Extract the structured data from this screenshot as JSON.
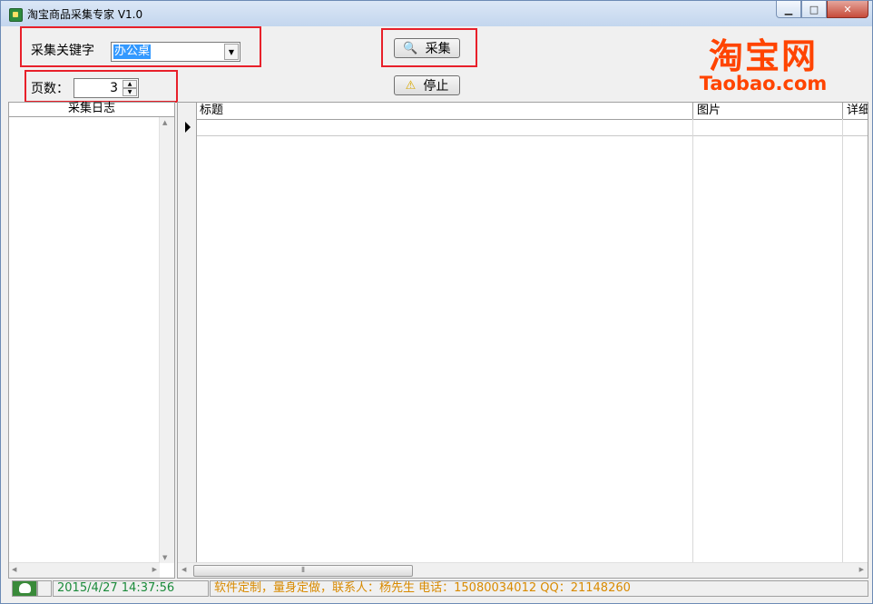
{
  "window": {
    "title": "淘宝商品采集专家 V1.0",
    "controls": {
      "minimize": "▁",
      "maximize": "□",
      "close": "✕"
    }
  },
  "form": {
    "keyword_label": "采集关键字",
    "keyword_value": "办公桌",
    "pages_label": "页数：",
    "pages_value": "3"
  },
  "buttons": {
    "collect_label": "采集",
    "stop_label": "停止"
  },
  "logo": {
    "cn": "淘宝网",
    "en": "Taobao.com"
  },
  "log_panel": {
    "header": "采集日志"
  },
  "grid": {
    "columns": [
      "标题",
      "图片",
      "详细"
    ]
  },
  "statusbar": {
    "datetime": "2015/4/27 14:37:56",
    "info": "软件定制，量身定做，联系人：杨先生 电话：15080034012  QQ：21148260"
  },
  "colors": {
    "highlight_box": "#e8202a",
    "logo": "#ff4400",
    "status_time": "#1a8a3a",
    "status_info": "#d88a00",
    "selection": "#3399ff"
  },
  "icons": {
    "app": "app-icon",
    "collect": "magnifier-icon",
    "stop": "warning-icon"
  }
}
